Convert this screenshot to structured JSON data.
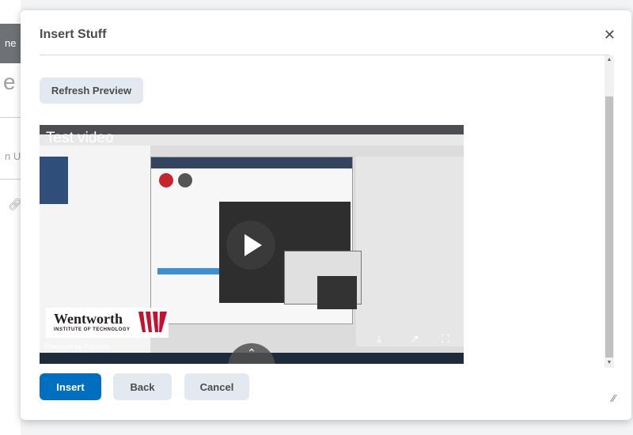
{
  "dialog": {
    "title": "Insert Stuff",
    "close_icon": "close-icon"
  },
  "toolbar": {
    "refresh_label": "Refresh Preview"
  },
  "video": {
    "title": "Test video",
    "logo_name": "Wentworth",
    "logo_subtitle": "INSTITUTE OF TECHNOLOGY",
    "powered_by": "Powered by Panopto",
    "play_icon": "play-icon",
    "download_icon": "download-icon",
    "popout_icon": "popout-icon",
    "fullscreen_icon": "fullscreen-icon",
    "expand_icon": "chevron-up-icon"
  },
  "footer": {
    "insert_label": "Insert",
    "back_label": "Back",
    "cancel_label": "Cancel"
  },
  "background": {
    "tab_text": "ne",
    "heading_fragment": "e",
    "text_fragment": "n U"
  },
  "colors": {
    "primary": "#006fbf",
    "secondary": "#e3e9f1",
    "title_text": "#494c4e"
  }
}
